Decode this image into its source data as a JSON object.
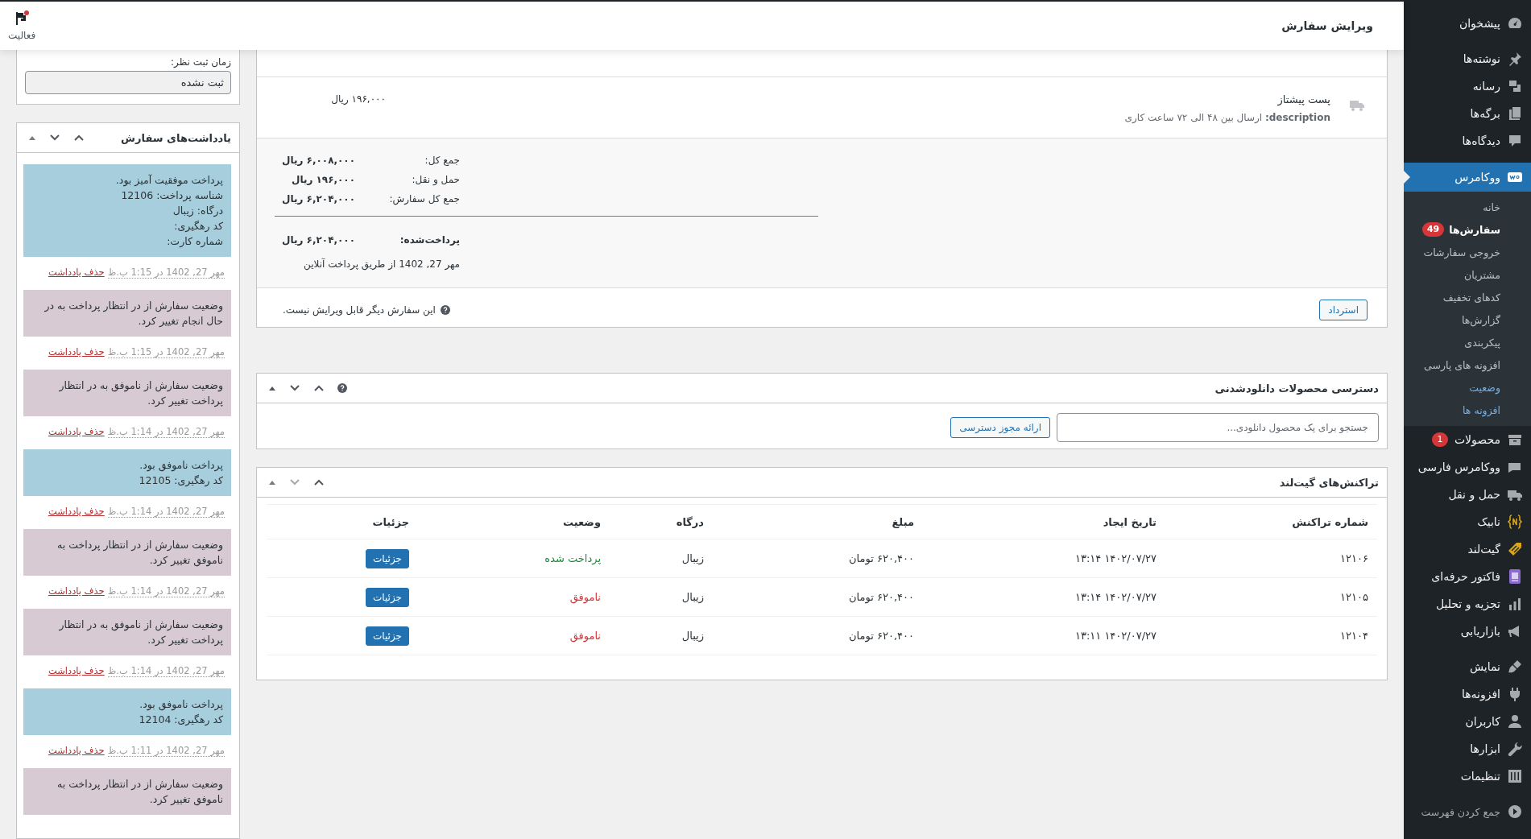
{
  "header": {
    "title": "ویرایش سفارش",
    "activity_label": "فعالیت",
    "activity_unread": true
  },
  "order_items": {
    "shipping": {
      "name": "پست پیشتاز",
      "meta": "**description:** ارسال بین ۴۸ الی ۷۲ ساعت کاری",
      "cost": "۱۹۶,۰۰۰ ریال"
    },
    "totals": [
      {
        "label": "جمع کل:",
        "value": "۶,۰۰۸,۰۰۰ ریال"
      },
      {
        "label": "حمل و نقل:",
        "value": "۱۹۶,۰۰۰ ریال"
      },
      {
        "label": "جمع کل سفارش:",
        "value": "۶,۲۰۴,۰۰۰ ریال"
      }
    ],
    "paid": {
      "label": "پرداخت‌شده:",
      "value": "۶,۲۰۴,۰۰۰ ریال",
      "note": "مهر 27, 1402 از طریق پرداخت آنلاین"
    },
    "refund_button": "استرداد",
    "locked_notice": "این سفارش دیگر قابل ویرایش نیست."
  },
  "downloads": {
    "title": "دسترسی محصولات دانلودشدنی",
    "search_placeholder": "جستجو برای یک محصول دانلودی...",
    "grant_button": "ارائه مجوز دسترسی"
  },
  "transactions": {
    "title": "تراکنش‌های گیت‌لند",
    "columns": [
      "شماره تراکنش",
      "تاریخ ایجاد",
      "مبلغ",
      "درگاه",
      "وضعیت",
      "جزئیات"
    ],
    "rows": [
      {
        "id": "۱۲۱۰۶",
        "created": "۱۴۰۲/۰۷/۲۷ ۱۳:۱۴",
        "amount": "۶۲۰,۴۰۰ تومان",
        "gateway": "زیبال",
        "status": "پرداخت شده",
        "kind": "paid",
        "details_button": "جزئیات"
      },
      {
        "id": "۱۲۱۰۵",
        "created": "۱۴۰۲/۰۷/۲۷ ۱۳:۱۴",
        "amount": "۶۲۰,۴۰۰ تومان",
        "gateway": "زیبال",
        "status": "ناموفق",
        "kind": "failed",
        "details_button": "جزئیات"
      },
      {
        "id": "۱۲۱۰۴",
        "created": "۱۴۰۲/۰۷/۲۷ ۱۳:۱۱",
        "amount": "۶۲۰,۴۰۰ تومان",
        "gateway": "زیبال",
        "status": "ناموفق",
        "kind": "failed",
        "details_button": "جزئیات"
      }
    ]
  },
  "review_box": {
    "label": "زمان ثبت نظر:",
    "value": "ثبت نشده"
  },
  "order_notes": {
    "title": "یادداشت‌های سفارش",
    "notes": [
      {
        "kind": "customer",
        "lines": [
          "پرداخت موفقیت آمیز بود.",
          "شناسه پرداخت: 12106",
          "درگاه: زیبال",
          "کد رهگیری:",
          "شماره کارت:"
        ],
        "date": "مهر 27, 1402 در 1:15 ب.ظ",
        "delete_link": "حذف یادداشت"
      },
      {
        "kind": "system",
        "lines": [
          "وضعیت سفارش از در انتظار پرداخت به در حال انجام تغییر کرد."
        ],
        "date": "مهر 27, 1402 در 1:15 ب.ظ",
        "delete_link": "حذف یادداشت"
      },
      {
        "kind": "system",
        "lines": [
          "وضعیت سفارش از ناموفق به در انتظار پرداخت تغییر کرد."
        ],
        "date": "مهر 27, 1402 در 1:14 ب.ظ",
        "delete_link": "حذف یادداشت"
      },
      {
        "kind": "customer",
        "lines": [
          "پرداخت ناموفق بود.",
          "کد رهگیری: 12105"
        ],
        "date": "مهر 27, 1402 در 1:14 ب.ظ",
        "delete_link": "حذف یادداشت"
      },
      {
        "kind": "system",
        "lines": [
          "وضعیت سفارش از در انتظار پرداخت به ناموفق تغییر کرد."
        ],
        "date": "مهر 27, 1402 در 1:14 ب.ظ",
        "delete_link": "حذف یادداشت"
      },
      {
        "kind": "system",
        "lines": [
          "وضعیت سفارش از ناموفق به در انتظار پرداخت تغییر کرد."
        ],
        "date": "مهر 27, 1402 در 1:14 ب.ظ",
        "delete_link": "حذف یادداشت"
      },
      {
        "kind": "customer",
        "lines": [
          "پرداخت ناموفق بود.",
          "کد رهگیری: 12104"
        ],
        "date": "مهر 27, 1402 در 1:11 ب.ظ",
        "delete_link": "حذف یادداشت"
      },
      {
        "kind": "system",
        "lines": [
          "وضعیت سفارش از در انتظار پرداخت به ناموفق تغییر کرد."
        ]
      }
    ]
  },
  "admin_menu": {
    "groups": [
      {
        "items": [
          {
            "label": "پیشخوان",
            "selected": false
          }
        ]
      },
      {
        "items": [
          {
            "label": "نوشته‌ها",
            "selected": false
          },
          {
            "label": "رسانه",
            "selected": false
          },
          {
            "label": "برگه‌ها",
            "selected": false
          },
          {
            "label": "دیدگاه‌ها",
            "selected": false
          }
        ]
      },
      {
        "items": [
          {
            "label": "ووکامرس",
            "selected": true,
            "submenu": [
              {
                "label": "خانه",
                "selected": false,
                "highlight": false
              },
              {
                "label": "سفارش‌ها",
                "selected": true,
                "highlight": false,
                "badge": "49"
              },
              {
                "label": "خروجی سفارشات",
                "selected": false,
                "highlight": false
              },
              {
                "label": "مشتریان",
                "selected": false,
                "highlight": false
              },
              {
                "label": "کدهای تخفیف",
                "selected": false,
                "highlight": false
              },
              {
                "label": "گزارش‌ها",
                "selected": false,
                "highlight": false
              },
              {
                "label": "پیکربندی",
                "selected": false,
                "highlight": false
              },
              {
                "label": "افزونه های پارسی",
                "selected": false,
                "highlight": false
              },
              {
                "label": "وضعیت",
                "selected": false,
                "highlight": true
              },
              {
                "label": "افزونه ها",
                "selected": false,
                "highlight": true
              }
            ]
          },
          {
            "label": "محصولات",
            "selected": false,
            "badge": "1"
          },
          {
            "label": "ووکامرس فارسی",
            "selected": false
          },
          {
            "label": "حمل و نقل",
            "selected": false
          },
          {
            "label": "نابیک",
            "selected": false
          },
          {
            "label": "گیت‌لند",
            "selected": false
          },
          {
            "label": "فاکتور حرفه‌ای",
            "selected": false
          },
          {
            "label": "تجزیه و تحلیل",
            "selected": false
          },
          {
            "label": "بازاریابی",
            "selected": false
          }
        ]
      },
      {
        "items": [
          {
            "label": "نمایش",
            "selected": false
          },
          {
            "label": "افزونه‌ها",
            "selected": false
          },
          {
            "label": "کاربران",
            "selected": false
          },
          {
            "label": "ابزارها",
            "selected": false
          },
          {
            "label": "تنظیمات",
            "selected": false
          }
        ]
      }
    ],
    "collapse_label": "جمع کردن فهرست"
  }
}
